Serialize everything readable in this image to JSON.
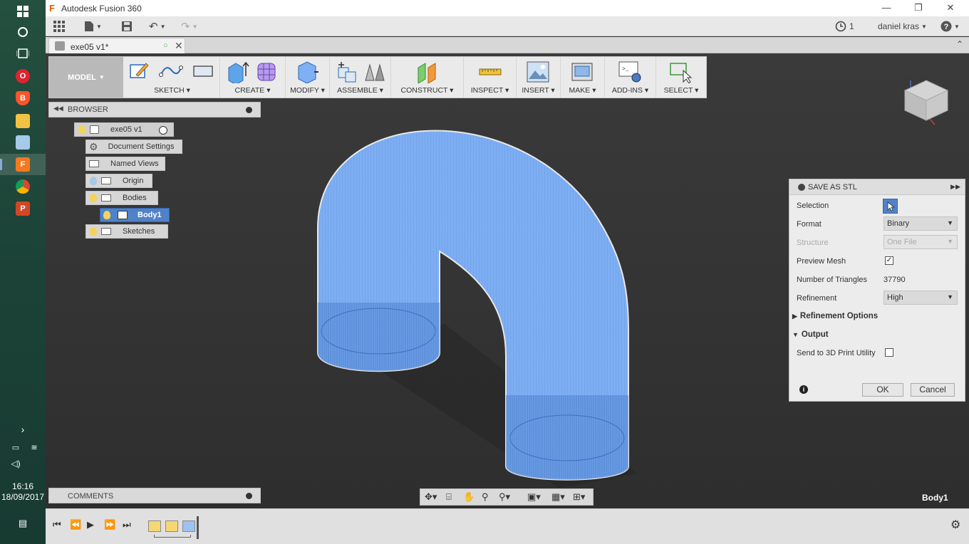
{
  "window": {
    "title": "Autodesk Fusion 360",
    "controls": [
      "minimize",
      "restore",
      "close"
    ]
  },
  "taskbar": {
    "time": "16:16",
    "date": "18/09/2017",
    "icons": [
      "windows-icon",
      "cortana-icon",
      "task-view-icon",
      "opera-icon",
      "brave-icon",
      "file-explorer-icon",
      "notepad-icon",
      "fusion-icon",
      "chrome-icon",
      "powerpoint-icon"
    ]
  },
  "qat": {
    "job_count": "1",
    "user": "daniel kras"
  },
  "tab": {
    "name": "exe05 v1*"
  },
  "ribbon": {
    "workspace": "MODEL",
    "groups": [
      {
        "label": "SKETCH"
      },
      {
        "label": "CREATE"
      },
      {
        "label": "MODIFY"
      },
      {
        "label": "ASSEMBLE"
      },
      {
        "label": "CONSTRUCT"
      },
      {
        "label": "INSPECT"
      },
      {
        "label": "INSERT"
      },
      {
        "label": "MAKE"
      },
      {
        "label": "ADD-INS"
      },
      {
        "label": "SELECT"
      }
    ]
  },
  "browser": {
    "title": "BROWSER",
    "root": "exe05 v1",
    "nodes": [
      {
        "label": "Document Settings"
      },
      {
        "label": "Named Views"
      },
      {
        "label": "Origin"
      },
      {
        "label": "Bodies"
      },
      {
        "label": "Body1"
      },
      {
        "label": "Sketches"
      }
    ]
  },
  "comments": {
    "title": "COMMENTS"
  },
  "status": {
    "selected_body": "Body1"
  },
  "stl_dialog": {
    "title": "SAVE AS STL",
    "selection_label": "Selection",
    "format_label": "Format",
    "format_value": "Binary",
    "structure_label": "Structure",
    "structure_value": "One File",
    "preview_label": "Preview Mesh",
    "preview_checked": true,
    "triangles_label": "Number of Triangles",
    "triangles_value": "37790",
    "refinement_label": "Refinement",
    "refinement_value": "High",
    "refinement_options": "Refinement Options",
    "output": "Output",
    "send_label": "Send to 3D Print Utility",
    "ok": "OK",
    "cancel": "Cancel"
  },
  "colors": {
    "model_blue": "#7fb0f4",
    "selection_blue": "#4f82c8",
    "fusion_orange": "#e05a00"
  }
}
